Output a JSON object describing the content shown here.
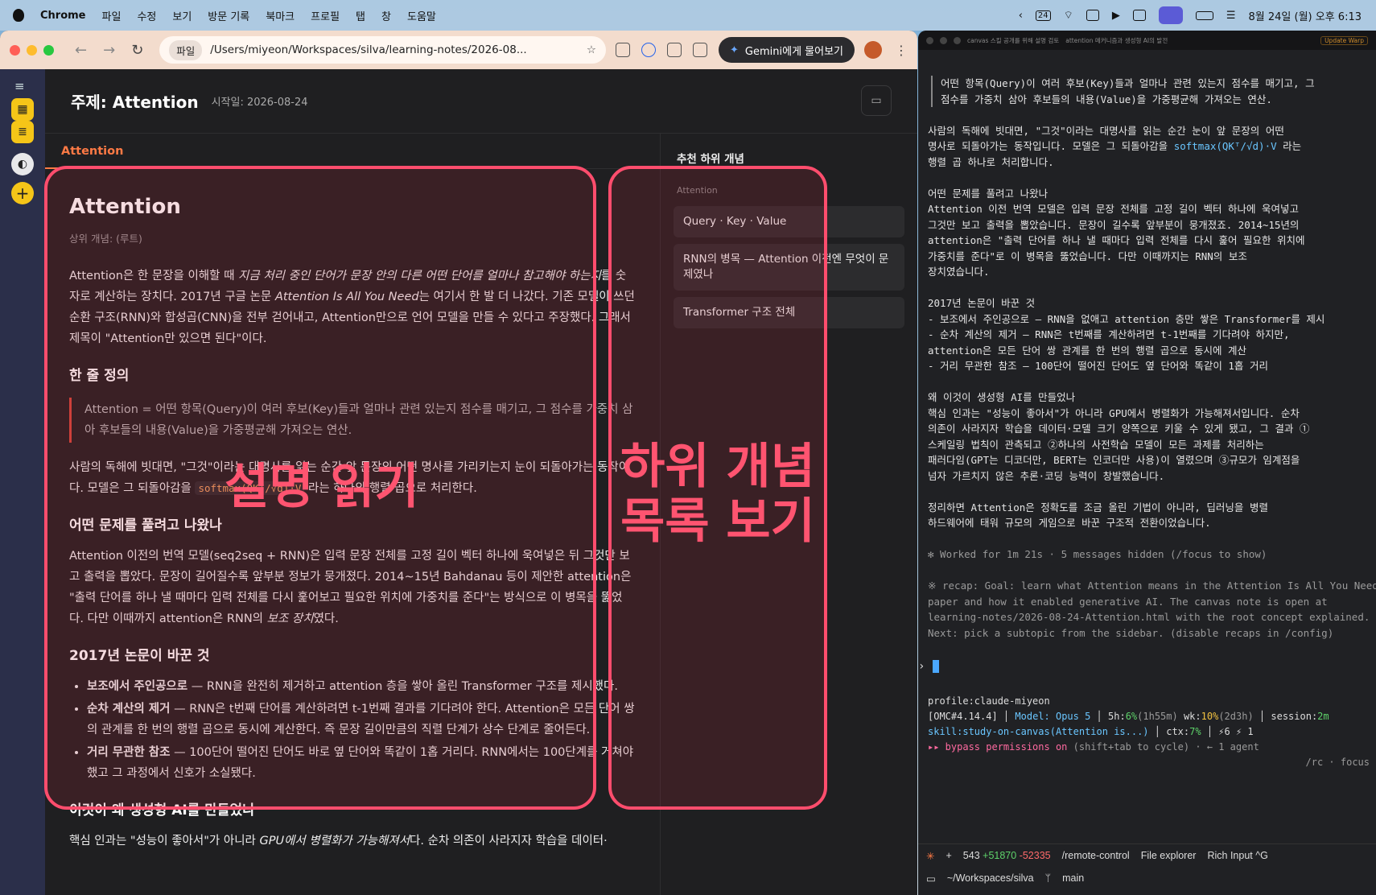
{
  "menubar": {
    "app": "Chrome",
    "items": [
      "파일",
      "수정",
      "보기",
      "방문 기록",
      "북마크",
      "프로필",
      "탭",
      "창",
      "도움말"
    ],
    "datetime": "8월 24일 (월) 오후 6:13",
    "badge": "24"
  },
  "browser": {
    "url_chip": "파일",
    "url": "/Users/miyeon/Workspaces/silva/learning-notes/2026-08...",
    "gemini_label": "Gemini에게 물어보기"
  },
  "canvas": {
    "title": "주제: Attention",
    "date": "시작일: 2026-08-24",
    "tab": "Attention",
    "article": {
      "title": "Attention",
      "parent": "상위 개념: (루트)",
      "intro_a": "Attention은 한 문장을 이해할 때 ",
      "intro_em": "지금 처리 중인 단어가 문장 안의 다른 어떤 단어를 얼마나 참고해야 하는지",
      "intro_b": "를 숫자로 계산하는 장치다. 2017년 구글 논문 ",
      "intro_em2": "Attention Is All You Need",
      "intro_c": "는 여기서 한 발 더 나갔다. 기존 모델이 쓰던 순환 구조(RNN)와 합성곱(CNN)을 전부 걷어내고, Attention만으로 언어 모델을 만들 수 있다고 주장했다. 그래서 제목이 \"Attention만 있으면 된다\"이다.",
      "h_def": "한 줄 정의",
      "definition": "Attention = 어떤 항목(Query)이 여러 후보(Key)들과 얼마나 관련 있는지 점수를 매기고, 그 점수를 가중치 삼아 후보들의 내용(Value)을 가중평균해 가져오는 연산.",
      "analogy_a": "사람의 독해에 빗대면, \"그것\"이라는 대명사를 읽는 순간 앞 문장의 어떤 명사를 가리키는지 눈이 되돌아가는 동작이다. 모델은 그 되돌아감을 ",
      "analogy_code": "softmax(QKᵀ/√d)·V",
      "analogy_b": " 라는 하나의 행렬 곱으로 처리한다.",
      "h_problem": "어떤 문제를 풀려고 나왔나",
      "problem_a": "Attention 이전의 번역 모델(seq2seq + RNN)은 입력 문장 전체를 고정 길이 벡터 하나에 욱여넣은 뒤 그것만 보고 출력을 뽑았다. 문장이 길어질수록 앞부분 정보가 뭉개졌다. 2014~15년 Bahdanau 등이 제안한 attention은 \"출력 단어를 하나 낼 때마다 입력 전체를 다시 훑어보고 필요한 위치에 가중치를 준다\"는 방식으로 이 병목을 뚫었다. 다만 이때까지 attention은 RNN의 ",
      "problem_em": "보조 장치",
      "problem_b": "였다.",
      "h_2017": "2017년 논문이 바꾼 것",
      "points": [
        {
          "b": "보조에서 주인공으로",
          "t": " — RNN을 완전히 제거하고 attention 층을 쌓아 올린 Transformer 구조를 제시했다."
        },
        {
          "b": "순차 계산의 제거",
          "t": " — RNN은 t번째 단어를 계산하려면 t-1번째 결과를 기다려야 한다. Attention은 모든 단어 쌍의 관계를 한 번의 행렬 곱으로 동시에 계산한다. 즉 문장 길이만큼의 직렬 단계가 상수 단계로 줄어든다."
        },
        {
          "b": "거리 무관한 참조",
          "t": " — 100단어 떨어진 단어도 바로 옆 단어와 똑같이 1홉 거리다. RNN에서는 100단계를 거쳐야 했고 그 과정에서 신호가 소실됐다."
        }
      ],
      "h_why": "이것이 왜 생성형 AI를 만들었나",
      "why_a": "핵심 인과는 \"성능이 좋아서\"가 아니라 ",
      "why_em": "GPU에서 병렬화가 가능해져서",
      "why_b": "다. 순차 의존이 사라지자 학습을 데이터·"
    },
    "side": {
      "header": "추천 하위 개념",
      "group": "Attention",
      "items": [
        "Query · Key · Value",
        "RNN의 병목 — Attention 이전엔 무엇이 문제였나",
        "Transformer 구조 전체"
      ]
    }
  },
  "overlays": {
    "left": "설명 읽기",
    "right_1": "하위 개념",
    "right_2": "목록 보기"
  },
  "terminal": {
    "tabs": [
      "canvas 스킬 공개를 위해 설명 검토",
      "attention 메커니즘과 생성형 AI의 발전"
    ],
    "update": "Update Warp",
    "lines": [
      {
        "t": "어떤 항목(Query)이 여러 후보(Key)들과 얼마나 관련 있는지 점수를 매기고, 그",
        "q": true
      },
      {
        "t": "점수를 가중치 삼아 후보들의 내용(Value)을 가중평균해 가져오는 연산.",
        "q": true
      },
      {
        "t": ""
      },
      {
        "t": "사람의 독해에 빗대면, \"그것\"이라는 대명사를 읽는 순간 눈이 앞 문장의 어떤"
      },
      {
        "t": "명사로 되돌아가는 동작입니다. 모델은 그 되돌아감을 ",
        "c": "softmax(QKᵀ/√d)·V",
        "e": " 라는"
      },
      {
        "t": "행렬 곱 하나로 처리합니다."
      },
      {
        "t": ""
      },
      {
        "t": "어떤 문제를 풀려고 나왔나"
      },
      {
        "t": "Attention 이전 번역 모델은 입력 문장 전체를 고정 길이 벡터 하나에 욱여넣고"
      },
      {
        "t": "그것만 보고 출력을 뽑았습니다. 문장이 길수록 앞부분이 뭉개졌죠. 2014~15년의"
      },
      {
        "t": "attention은 \"출력 단어를 하나 낼 때마다 입력 전체를 다시 훑어 필요한 위치에"
      },
      {
        "t": "가중치를 준다\"로 이 병목을 뚫었습니다. 다만 이때까지는 RNN의 보조"
      },
      {
        "t": "장치였습니다."
      },
      {
        "t": ""
      },
      {
        "t": "2017년 논문이 바꾼 것"
      },
      {
        "t": "- 보조에서 주인공으로 — RNN을 없애고 attention 층만 쌓은 Transformer를 제시"
      },
      {
        "t": "- 순차 계산의 제거 — RNN은 t번째를 계산하려면 t-1번째를 기다려야 하지만,"
      },
      {
        "t": "attention은 모든 단어 쌍 관계를 한 번의 행렬 곱으로 동시에 계산"
      },
      {
        "t": "- 거리 무관한 참조 — 100단어 떨어진 단어도 옆 단어와 똑같이 1홉 거리"
      },
      {
        "t": ""
      },
      {
        "t": "왜 이것이 생성형 AI를 만들었나"
      },
      {
        "t": "핵심 인과는 \"성능이 좋아서\"가 아니라 GPU에서 병렬화가 가능해져서입니다. 순차"
      },
      {
        "t": "의존이 사라지자 학습을 데이터·모델 크기 양쪽으로 키울 수 있게 됐고, 그 결과 ①"
      },
      {
        "t": "스케일링 법칙이 관측되고 ②하나의 사전학습 모델이 모든 과제를 처리하는"
      },
      {
        "t": "패러다임(GPT는 디코더만, BERT는 인코더만 사용)이 열렸으며 ③규모가 임계점을"
      },
      {
        "t": "넘자 가르치지 않은 추론·코딩 능력이 창발했습니다."
      },
      {
        "t": ""
      },
      {
        "t": "정리하면 Attention은 정확도를 조금 올린 기법이 아니라, 딥러닝을 병렬"
      },
      {
        "t": "하드웨어에 태워 규모의 게임으로 바꾼 구조적 전환이었습니다."
      }
    ],
    "worked": "✻ Worked for 1m 21s · 5 messages hidden (/focus to show)",
    "recap": [
      "※ recap: Goal: learn what Attention means in the Attention Is All You Need",
      "paper and how it enabled generative AI. The canvas note is open at",
      "learning-notes/2026-08-24-Attention.html with the root concept explained.",
      "Next: pick a subtopic from the sidebar. (disable recaps in /config)"
    ],
    "prompt": "›",
    "status": {
      "profile": "profile:claude-miyeon",
      "omc": "[OMC#4.14.4]",
      "model": "Model: Opus 5",
      "h5": "5h:",
      "h5v": "6%",
      "h5b": "(1h55m)",
      "wk": "wk:",
      "wkv": "10%",
      "wkb": "(2d3h)",
      "session": "session:",
      "sessionv": "2m",
      "skill": "skill:study-on-canvas(Attention is...)",
      "ctx": "ctx:",
      "ctxv": "7%",
      "rest": "⚡6 ⚡ 1",
      "bypass": "▸▸ bypass permissions on",
      "bypass2": " (shift+tab to cycle) · ← 1 agent",
      "rc": "/rc · focus"
    },
    "footer": {
      "plus": "+",
      "changes": "543",
      "add": "+51870",
      "del": "-52335",
      "remote": "/remote-control",
      "explorer": "File explorer",
      "rich": "Rich Input ^G",
      "path": "~/Workspaces/silva",
      "branch": "main"
    }
  }
}
